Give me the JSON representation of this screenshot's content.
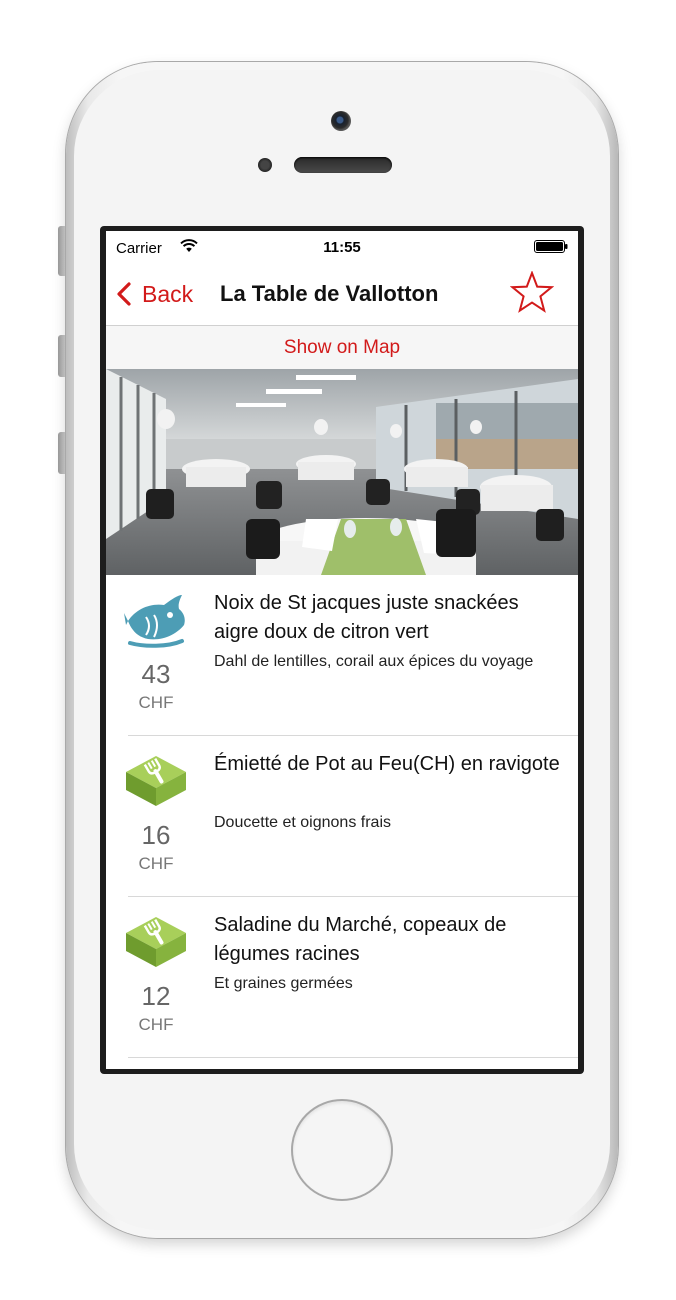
{
  "status_bar": {
    "carrier": "Carrier",
    "time": "11:55"
  },
  "nav": {
    "back_label": "Back",
    "title": "La Table de Vallotton",
    "favorite_icon": "star-outline-icon"
  },
  "map_link": "Show on Map",
  "colors": {
    "accent": "#d21a1a",
    "fish_icon": "#4d9db5",
    "fork_icon": "#7cb03a"
  },
  "menu": {
    "items": [
      {
        "icon": "fish-icon",
        "title": "Noix de St jacques juste snackées aigre doux de citron vert",
        "description": "Dahl de lentilles, corail aux épices du voyage",
        "price": "43",
        "currency": "CHF"
      },
      {
        "icon": "fork-icon",
        "title": "Émietté de Pot au Feu(CH) en ravigote",
        "description": "Doucette et oignons frais",
        "price": "16",
        "currency": "CHF"
      },
      {
        "icon": "fork-icon",
        "title": "Saladine du Marché, copeaux de légumes racines",
        "description": "Et graines germées",
        "price": "12",
        "currency": "CHF"
      }
    ]
  }
}
